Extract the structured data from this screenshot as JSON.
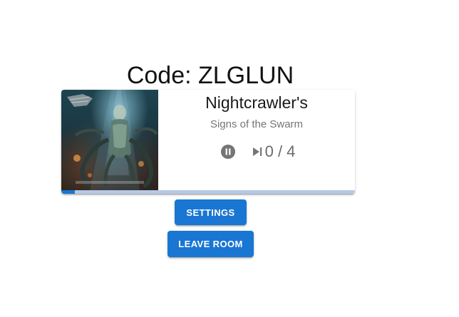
{
  "room": {
    "code_text": "Code: ZLGLUN"
  },
  "player": {
    "title": "Nightcrawler's",
    "artist": "Signs of the Swarm",
    "is_playing": true,
    "votes_text": "0 / 4",
    "progress_fraction": 0.045,
    "icons": {
      "play_pause": "pause-circle-icon",
      "skip": "skip-next-icon"
    },
    "colors": {
      "progress_fill": "#1976d2",
      "progress_track": "#b5c9e8",
      "icon": "#757575"
    }
  },
  "actions": {
    "settings_label": "SETTINGS",
    "leave_label": "LEAVE ROOM",
    "button_color": "#1976d2"
  }
}
